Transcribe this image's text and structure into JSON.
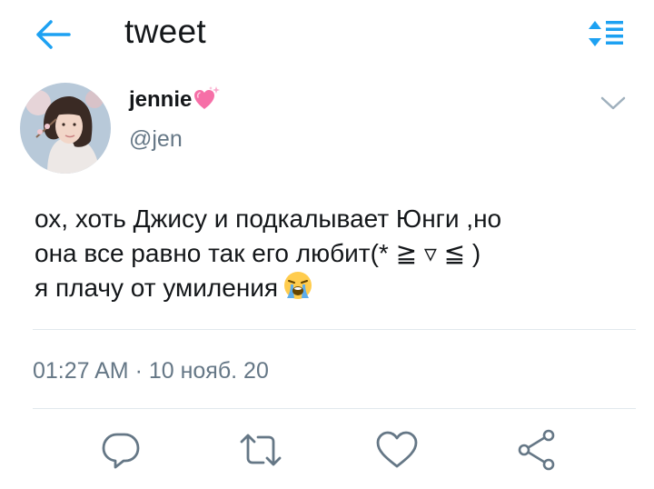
{
  "header": {
    "title": "tweet",
    "back_icon": "arrow-left-icon",
    "sort_icon": "sort-list-icon",
    "accent_color": "#1da1f2"
  },
  "tweet": {
    "author": {
      "display_name": "jennie",
      "name_emoji": "sparkling-heart-emoji",
      "handle": "@jen",
      "avatar": "profile-photo"
    },
    "text_lines": [
      "ох, хоть Джису и подкалывает Юнги ,но",
      "она все равно так его любит(* ≧ ▿ ≦ )",
      "я плачу от умиления"
    ],
    "text_emoji": "loudly-crying-face-emoji",
    "timestamp": "01:27 AM · 10 нояб. 20"
  },
  "actions": [
    {
      "name": "reply",
      "icon": "reply-icon"
    },
    {
      "name": "retweet",
      "icon": "retweet-icon"
    },
    {
      "name": "like",
      "icon": "heart-icon"
    },
    {
      "name": "share",
      "icon": "share-icon"
    }
  ],
  "colors": {
    "text": "#14171a",
    "secondary": "#657786",
    "divider": "#e1e8ed",
    "icon": "#657786"
  }
}
